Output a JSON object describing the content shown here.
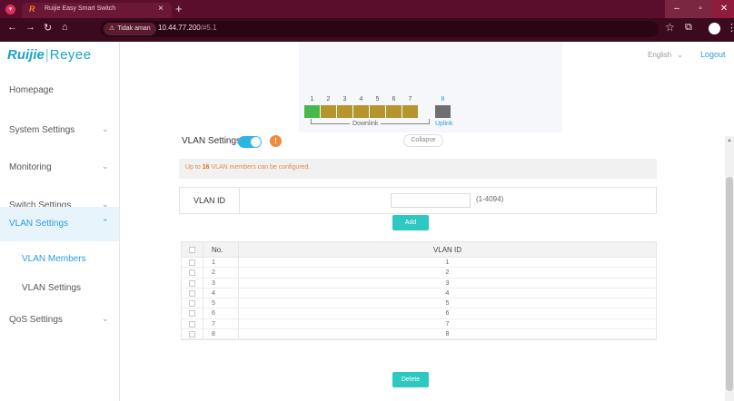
{
  "browser": {
    "tab_title": "Ruijie Easy Smart Switch",
    "tab_favicon": "R",
    "security_warning": "Tidak aman",
    "url_host": "10.44.77.200",
    "url_path": "/#5.1",
    "icons": [
      "menu-icon",
      "back-icon",
      "forward-icon",
      "reload-icon",
      "home-icon",
      "star-icon",
      "extensions-icon",
      "profile-icon",
      "more-icon"
    ]
  },
  "brand": {
    "ruijie": "Ruijie",
    "separator": "|",
    "reyee": "Reyee",
    "color": "#1aa3c7"
  },
  "header": {
    "language": "English",
    "logout": "Logout"
  },
  "sidebar": {
    "items": [
      {
        "label": "Homepage",
        "chevron": ""
      },
      {
        "label": "System Settings",
        "chevron": "⌄"
      },
      {
        "label": "Monitoring",
        "chevron": "⌄"
      },
      {
        "label": "Switch Settings",
        "chevron": "⌄"
      },
      {
        "label": "VLAN Settings",
        "chevron": "⌃"
      },
      {
        "label": "VLAN Members",
        "chevron": ""
      },
      {
        "label": "VLAN Settings",
        "chevron": ""
      },
      {
        "label": "QoS Settings",
        "chevron": "⌄"
      }
    ],
    "active_color": "#2d9cdb"
  },
  "switch_panel": {
    "ports": [
      "1",
      "2",
      "3",
      "4",
      "5",
      "6",
      "7",
      "8"
    ],
    "downlink_label": "Downlink",
    "uplink_label": "Uplink",
    "collapse_label": "Collapse"
  },
  "vlan_settings": {
    "title": "VLAN Settings",
    "enabled": true,
    "help_glyph": "!",
    "note_prefix": "Up to",
    "note_count": "16",
    "note_suffix": "VLAN members can be configured.",
    "form_label": "VLAN ID",
    "input_value": "",
    "range_hint": "(1-4094)",
    "add_label": "Add",
    "delete_label": "Delete",
    "accent": "#2dc8c0"
  },
  "table": {
    "columns": [
      "No.",
      "VLAN ID"
    ],
    "rows": [
      {
        "no": "1",
        "vlan_id": "1"
      },
      {
        "no": "2",
        "vlan_id": "2"
      },
      {
        "no": "3",
        "vlan_id": "3"
      },
      {
        "no": "4",
        "vlan_id": "4"
      },
      {
        "no": "5",
        "vlan_id": "5"
      },
      {
        "no": "6",
        "vlan_id": "6"
      },
      {
        "no": "7",
        "vlan_id": "7"
      },
      {
        "no": "8",
        "vlan_id": "8"
      }
    ]
  }
}
